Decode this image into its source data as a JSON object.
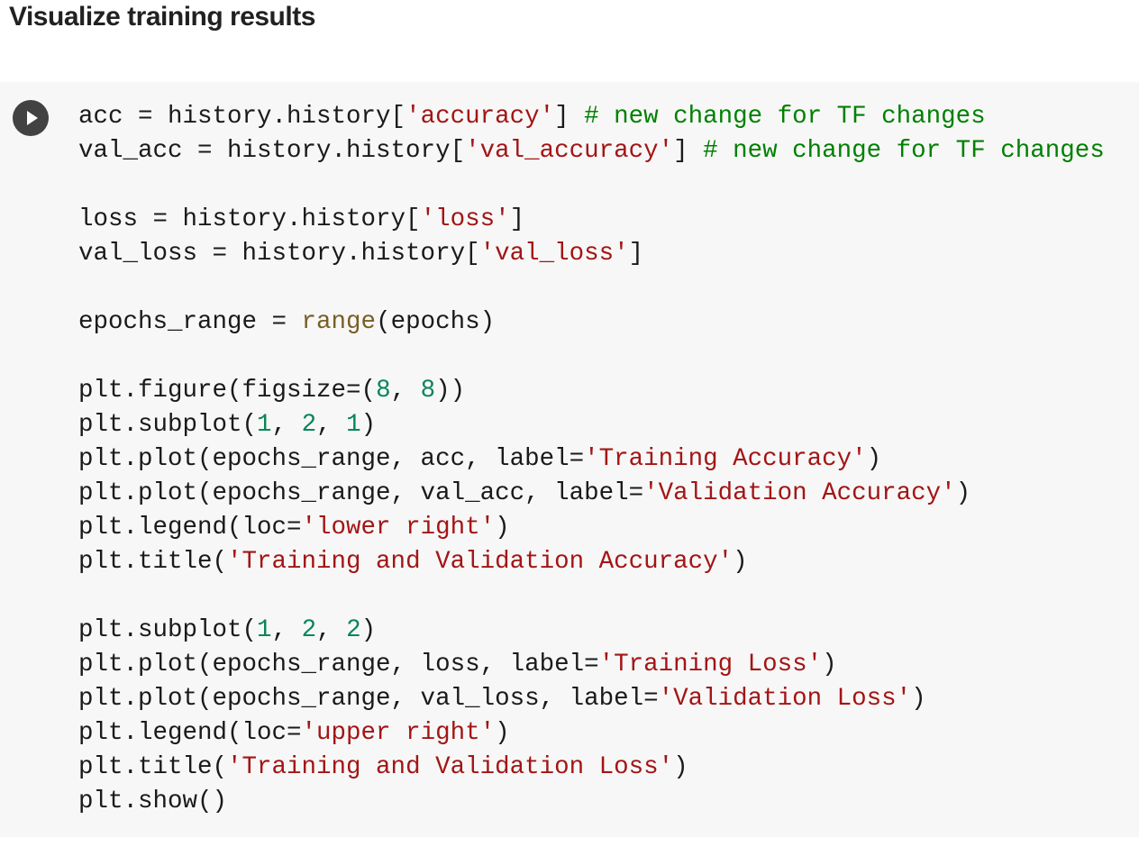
{
  "heading": "Visualize training results",
  "cell": {
    "run_button": {
      "icon": "play-icon",
      "color": "#424242"
    },
    "colors": {
      "default": "#1a1a1a",
      "string": "#a31515",
      "comment": "#008000",
      "number": "#098658",
      "builtin": "#795e26",
      "background": "#f7f7f7"
    },
    "lines": [
      [
        [
          "acc = history.history[",
          ""
        ],
        [
          "'accuracy'",
          "s"
        ],
        [
          "] ",
          ""
        ],
        [
          "# new change for TF changes",
          "c"
        ]
      ],
      [
        [
          "val_acc = history.history[",
          ""
        ],
        [
          "'val_accuracy'",
          "s"
        ],
        [
          "] ",
          ""
        ],
        [
          "# new change for TF changes",
          "c"
        ]
      ],
      [],
      [
        [
          "loss = history.history[",
          ""
        ],
        [
          "'loss'",
          "s"
        ],
        [
          "]",
          ""
        ]
      ],
      [
        [
          "val_loss = history.history[",
          ""
        ],
        [
          "'val_loss'",
          "s"
        ],
        [
          "]",
          ""
        ]
      ],
      [],
      [
        [
          "epochs_range = ",
          ""
        ],
        [
          "range",
          "b"
        ],
        [
          "(epochs)",
          ""
        ]
      ],
      [],
      [
        [
          "plt.figure(figsize=(",
          ""
        ],
        [
          "8",
          "n"
        ],
        [
          ", ",
          ""
        ],
        [
          "8",
          "n"
        ],
        [
          "))",
          ""
        ]
      ],
      [
        [
          "plt.subplot(",
          ""
        ],
        [
          "1",
          "n"
        ],
        [
          ", ",
          ""
        ],
        [
          "2",
          "n"
        ],
        [
          ", ",
          ""
        ],
        [
          "1",
          "n"
        ],
        [
          ")",
          ""
        ]
      ],
      [
        [
          "plt.plot(epochs_range, acc, label=",
          ""
        ],
        [
          "'Training Accuracy'",
          "s"
        ],
        [
          ")",
          ""
        ]
      ],
      [
        [
          "plt.plot(epochs_range, val_acc, label=",
          ""
        ],
        [
          "'Validation Accuracy'",
          "s"
        ],
        [
          ")",
          ""
        ]
      ],
      [
        [
          "plt.legend(loc=",
          ""
        ],
        [
          "'lower right'",
          "s"
        ],
        [
          ")",
          ""
        ]
      ],
      [
        [
          "plt.title(",
          ""
        ],
        [
          "'Training and Validation Accuracy'",
          "s"
        ],
        [
          ")",
          ""
        ]
      ],
      [],
      [
        [
          "plt.subplot(",
          ""
        ],
        [
          "1",
          "n"
        ],
        [
          ", ",
          ""
        ],
        [
          "2",
          "n"
        ],
        [
          ", ",
          ""
        ],
        [
          "2",
          "n"
        ],
        [
          ")",
          ""
        ]
      ],
      [
        [
          "plt.plot(epochs_range, loss, label=",
          ""
        ],
        [
          "'Training Loss'",
          "s"
        ],
        [
          ")",
          ""
        ]
      ],
      [
        [
          "plt.plot(epochs_range, val_loss, label=",
          ""
        ],
        [
          "'Validation Loss'",
          "s"
        ],
        [
          ")",
          ""
        ]
      ],
      [
        [
          "plt.legend(loc=",
          ""
        ],
        [
          "'upper right'",
          "s"
        ],
        [
          ")",
          ""
        ]
      ],
      [
        [
          "plt.title(",
          ""
        ],
        [
          "'Training and Validation Loss'",
          "s"
        ],
        [
          ")",
          ""
        ]
      ],
      [
        [
          "plt.show()",
          ""
        ]
      ]
    ]
  }
}
